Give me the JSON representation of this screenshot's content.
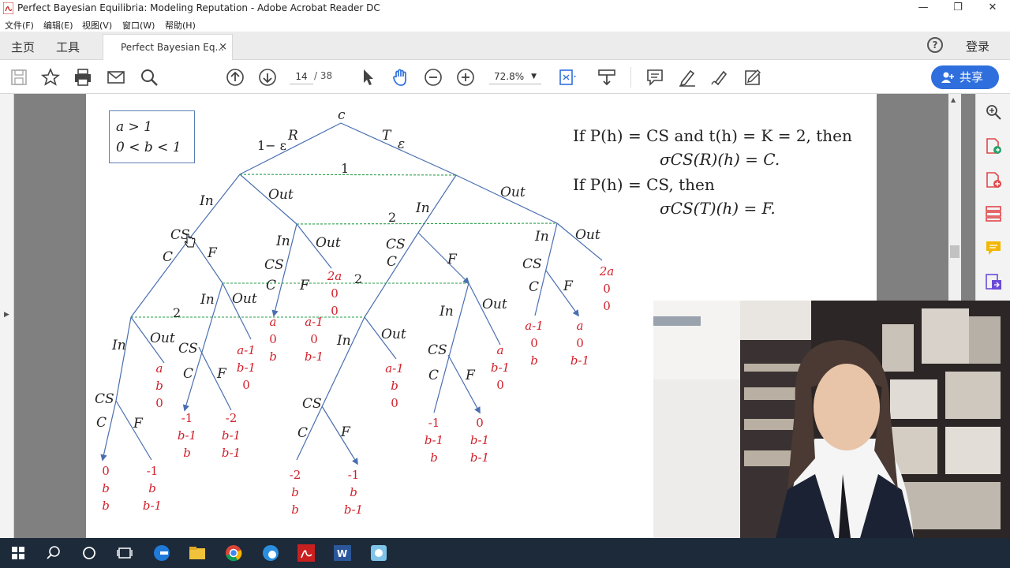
{
  "window": {
    "title": "Perfect Bayesian Equilibria: Modeling Reputation - Adobe Acrobat Reader DC",
    "minimize": "—",
    "maximize": "❐",
    "close": "✕"
  },
  "menu": [
    "文件(F)",
    "编辑(E)",
    "视图(V)",
    "窗口(W)",
    "帮助(H)"
  ],
  "tabs": {
    "home": "主页",
    "tools": "工具",
    "doc": "Perfect Bayesian Eq...",
    "doc_close": "×",
    "help": "?",
    "login": "登录"
  },
  "toolbar": {
    "page_current": "14",
    "page_total": "/ 38",
    "zoom": "72.8%",
    "share": "共享",
    "icons": [
      "save-icon",
      "bookmark-star-icon",
      "print-icon",
      "email-icon",
      "search-icon",
      "page-up-icon",
      "page-down-icon",
      "select-cursor-icon",
      "hand-icon",
      "zoom-out-icon",
      "zoom-in-icon",
      "fit-page-icon",
      "scroll-mode-icon",
      "comment-icon",
      "highlight-icon",
      "sign-icon",
      "more-tools-icon"
    ]
  },
  "document": {
    "conditions": [
      "a > 1",
      "0 < b < 1"
    ],
    "rule1_line1": "If P(h) = CS and t(h) = K = 2, then",
    "rule1_line2": "σCS(R)(h) = C.",
    "rule2_line1": "If P(h) = CS, then",
    "rule2_line2": "σCS(T)(h) = F.",
    "tree_labels": {
      "root": "c",
      "root_left_prob": "1− ε",
      "root_left_action": "R",
      "root_right_action": "T",
      "root_right_prob": "ε",
      "info1": "1",
      "info2a": "2",
      "info2b": "2",
      "info2c": "2",
      "in": "In",
      "out": "Out",
      "cs": "CS",
      "c": "C",
      "f": "F"
    },
    "payoffs": [
      [
        "0",
        "b",
        "b"
      ],
      [
        "-1",
        "b",
        "b-1"
      ],
      [
        "a",
        "b",
        "0"
      ],
      [
        "-1",
        "b-1",
        "b"
      ],
      [
        "-2",
        "b-1",
        "b-1"
      ],
      [
        "a-1",
        "b-1",
        "0"
      ],
      [
        "a",
        "0",
        "b"
      ],
      [
        "a-1",
        "0",
        "b-1"
      ],
      [
        "2a",
        "0",
        "0"
      ],
      [
        "-2",
        "b",
        "b"
      ],
      [
        "-1",
        "b",
        "b-1"
      ],
      [
        "a-1",
        "b",
        "0"
      ],
      [
        "-1",
        "b-1",
        "b"
      ],
      [
        "0",
        "b-1",
        "b-1"
      ],
      [
        "a",
        "b-1",
        "0"
      ],
      [
        "a-1",
        "0",
        "b"
      ],
      [
        "a",
        "0",
        "b-1"
      ],
      [
        "2a",
        "0",
        "0"
      ]
    ]
  },
  "right_tools": [
    "zoom-doc-icon",
    "export-pdf-icon",
    "create-pdf-icon",
    "organize-pages-icon",
    "comment-tool-icon",
    "send-sign-icon"
  ],
  "taskbar": [
    "windows-start-icon",
    "search-icon",
    "cortana-icon",
    "task-view-icon",
    "edge-icon",
    "file-explorer-icon",
    "chrome-icon",
    "edge-alt-icon",
    "acrobat-icon",
    "word-icon",
    "app-icon"
  ],
  "colors": {
    "share_button": "#2f6fdd",
    "payoff_red": "#d2202a",
    "tree_lines": "#4a6fb0",
    "info_set_green": "#2a9d4a"
  }
}
